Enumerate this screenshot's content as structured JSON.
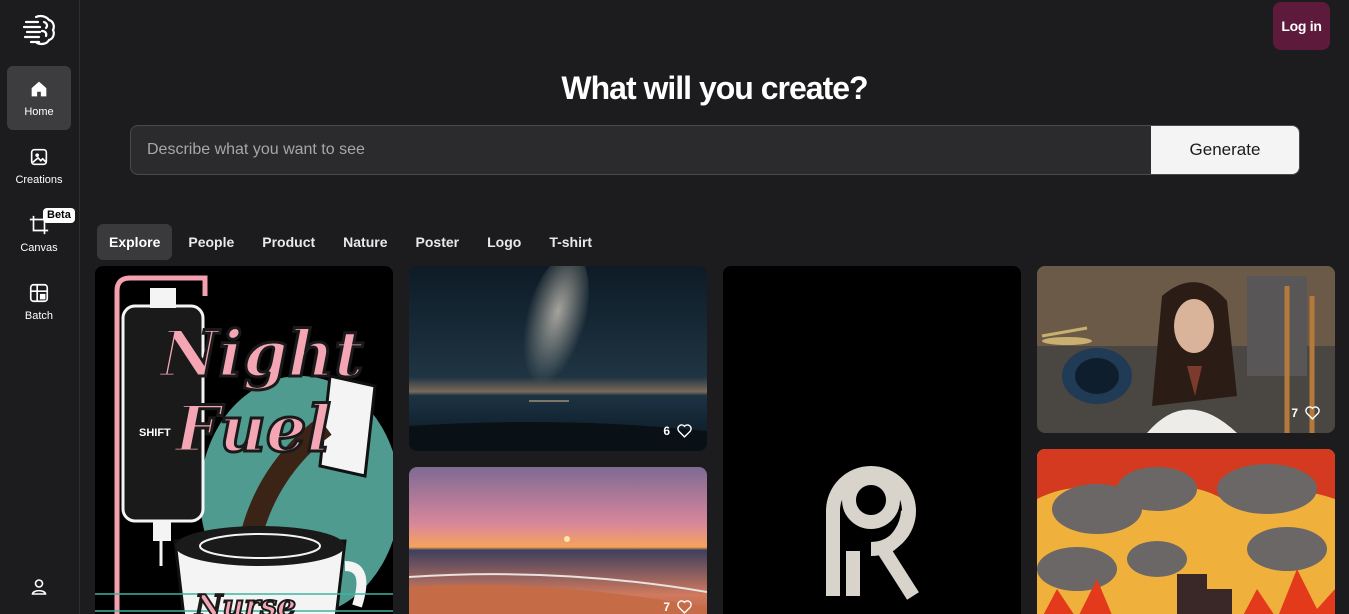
{
  "sidebar": {
    "items": [
      {
        "label": "Home",
        "icon": "home-icon",
        "active": true
      },
      {
        "label": "Creations",
        "icon": "image-icon"
      },
      {
        "label": "Canvas",
        "icon": "crop-icon",
        "badge": "Beta"
      },
      {
        "label": "Batch",
        "icon": "grid-icon"
      }
    ]
  },
  "header": {
    "login_label": "Log in",
    "headline": "What will you create?"
  },
  "prompt": {
    "placeholder": "Describe what you want to see",
    "value": "",
    "generate_label": "Generate"
  },
  "tabs": [
    "Explore",
    "People",
    "Product",
    "Nature",
    "Poster",
    "Logo",
    "T-shirt"
  ],
  "gallery": [
    {
      "alt": "Night Fuel Nurse poster",
      "poster_text": [
        "Night",
        "Fuel",
        "SHIFT",
        "Nurse"
      ]
    },
    {
      "alt": "Milky way over ocean",
      "likes": "6"
    },
    {
      "alt": "Sunset beach",
      "likes": "7"
    },
    {
      "alt": "R monogram logo"
    },
    {
      "alt": "Woman with drums",
      "likes": "7"
    },
    {
      "alt": "Burning city illustration"
    }
  ],
  "colors": {
    "accent": "#5e1a3b",
    "background": "#1c1b1d"
  }
}
